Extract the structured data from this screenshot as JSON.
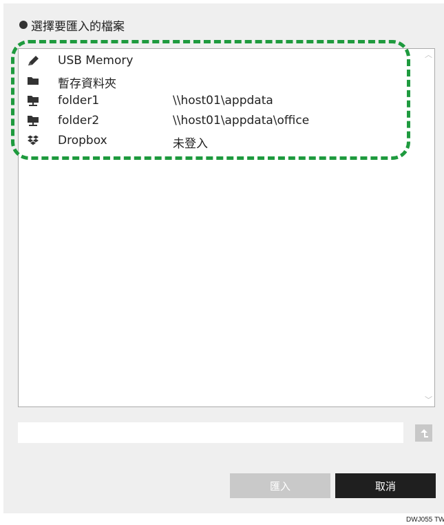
{
  "dialog": {
    "title": "選擇要匯入的檔案"
  },
  "file_list": {
    "items": [
      {
        "icon": "usb-pen-icon",
        "name": "USB Memory",
        "path": ""
      },
      {
        "icon": "folder-icon",
        "name": "暫存資料夾",
        "path": ""
      },
      {
        "icon": "network-folder-icon",
        "name": "folder1",
        "path": "\\\\host01\\appdata"
      },
      {
        "icon": "network-folder-icon",
        "name": "folder2",
        "path": "\\\\host01\\appdata\\office"
      },
      {
        "icon": "dropbox-icon",
        "name": "Dropbox",
        "path": "未登入"
      }
    ]
  },
  "path_bar": {
    "value": ""
  },
  "buttons": {
    "import_label": "匯入",
    "cancel_label": "取消"
  },
  "figure_code": "DWJ055 TW",
  "colors": {
    "panel_background": "#efefef",
    "highlight_dash": "#1e9a3e",
    "import_disabled": "#c9c9c9",
    "cancel_background": "#1f1f1f"
  }
}
